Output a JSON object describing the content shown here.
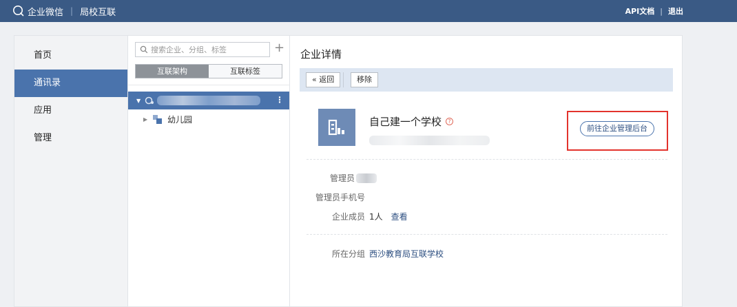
{
  "topbar": {
    "app_name": "企业微信",
    "module": "局校互联",
    "links": [
      "API文档",
      "退出"
    ]
  },
  "sidebar": {
    "items": [
      {
        "label": "首页",
        "active": false
      },
      {
        "label": "通讯录",
        "active": true
      },
      {
        "label": "应用",
        "active": false
      },
      {
        "label": "管理",
        "active": false
      }
    ]
  },
  "tree": {
    "search_placeholder": "搜索企业、分组、标签",
    "tabs": [
      {
        "label": "互联架构",
        "active": true
      },
      {
        "label": "互联标签",
        "active": false
      }
    ],
    "child": {
      "label": "幼儿园"
    }
  },
  "detail": {
    "title": "企业详情",
    "back_label": "返回",
    "remove_label": "移除",
    "corp_name": "自己建一个学校",
    "goto_admin_label": "前往企业管理后台",
    "fields": {
      "admin_label": "管理员",
      "phone_label": "管理员手机号",
      "members_label": "企业成员",
      "members_value": "1人",
      "members_link": "查看",
      "group_label": "所在分组",
      "group_value": "西沙教育局互联学校"
    }
  },
  "colors": {
    "topbar": "#3a5a85",
    "accent": "#4a73ac",
    "highlight": "#e3322c"
  }
}
